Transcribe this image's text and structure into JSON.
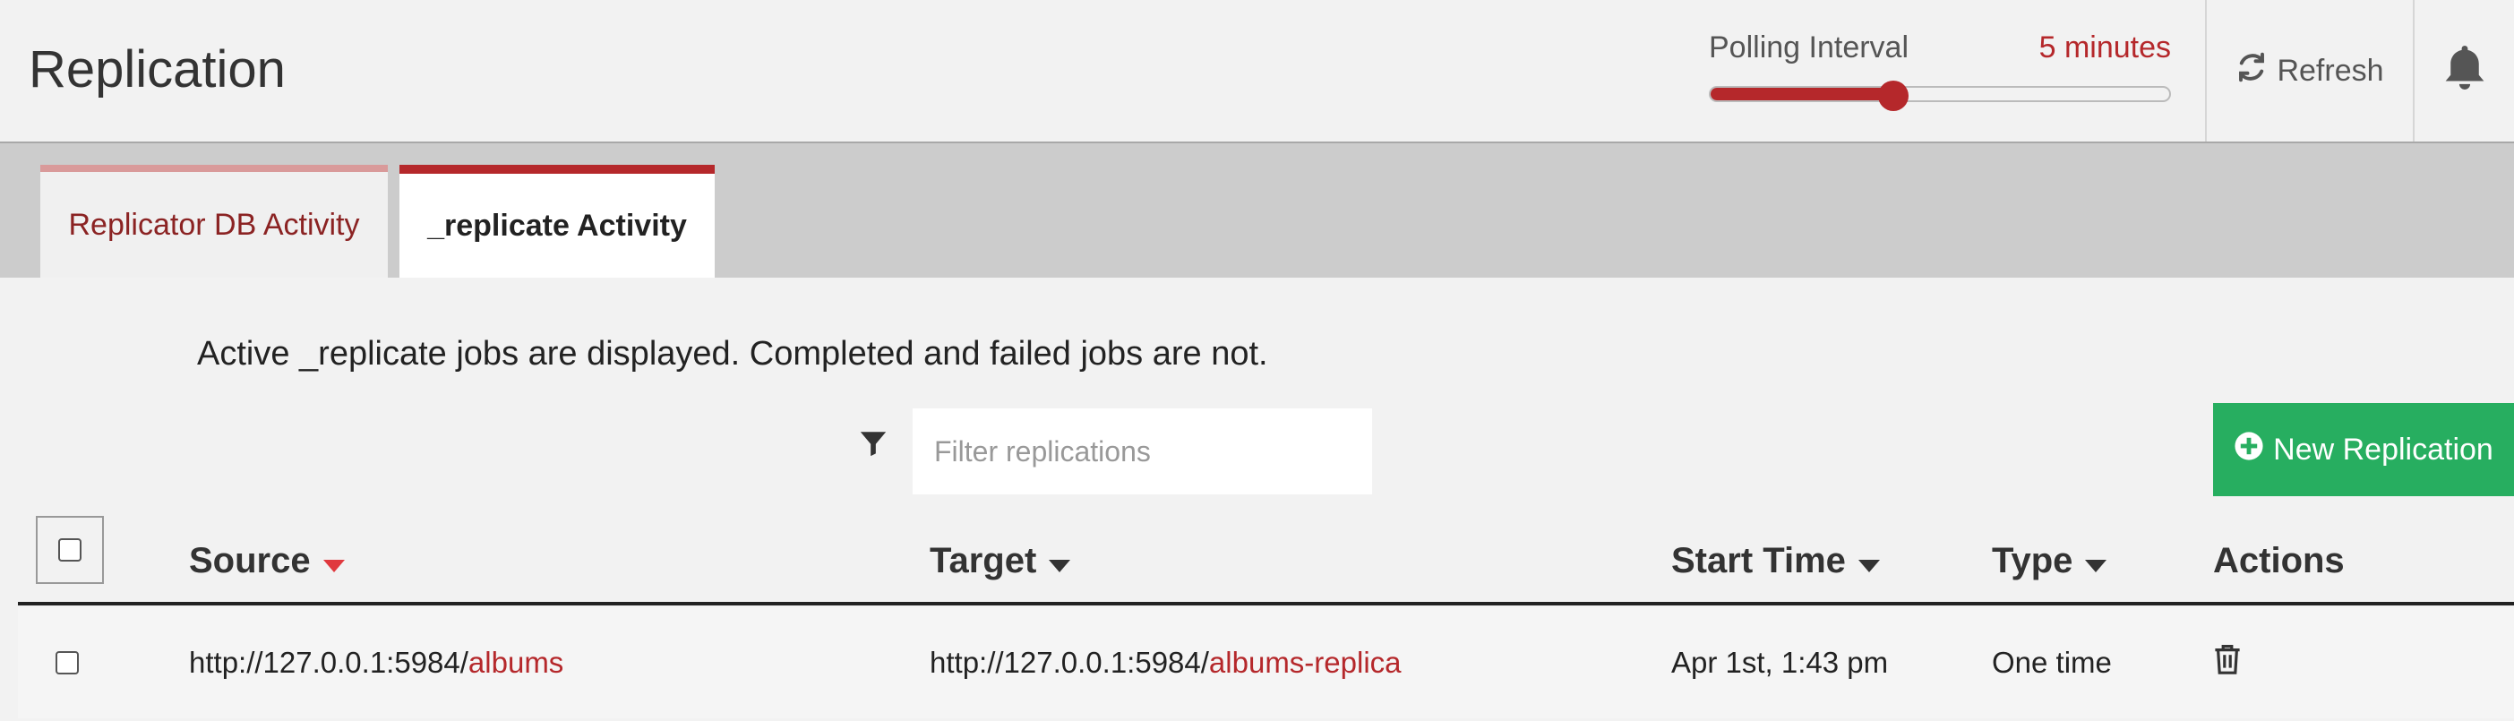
{
  "header": {
    "title": "Replication",
    "polling": {
      "label": "Polling Interval",
      "value_text": "5 minutes",
      "fraction": 0.4
    },
    "refresh_label": "Refresh",
    "icons": {
      "refresh": "refresh-icon",
      "notifications": "bell-icon"
    }
  },
  "tabs": [
    {
      "label": "Replicator DB Activity",
      "active": false
    },
    {
      "label": "_replicate Activity",
      "active": true
    }
  ],
  "info_text": "Active _replicate jobs are displayed. Completed and failed jobs are not.",
  "filter": {
    "placeholder": "Filter replications",
    "value": "",
    "icon": "filter-icon"
  },
  "new_replication_label": "New Replication",
  "table": {
    "columns": [
      {
        "label": "Source",
        "sort": "active-desc"
      },
      {
        "label": "Target",
        "sort": "desc"
      },
      {
        "label": "Start Time",
        "sort": "desc"
      },
      {
        "label": "Type",
        "sort": "desc"
      },
      {
        "label": "Actions"
      }
    ],
    "rows": [
      {
        "source_prefix": "http://127.0.0.1:5984/",
        "source_db": "albums",
        "target_prefix": "http://127.0.0.1:5984/",
        "target_db": "albums-replica",
        "start_time": "Apr 1st, 1:43 pm",
        "type": "One time",
        "checked": false
      }
    ]
  },
  "colors": {
    "accent": "#b5282b",
    "sort_active": "#e0393e",
    "success": "#27ae60",
    "tabs_band": "#cccccc",
    "background": "#f2f2f2"
  }
}
